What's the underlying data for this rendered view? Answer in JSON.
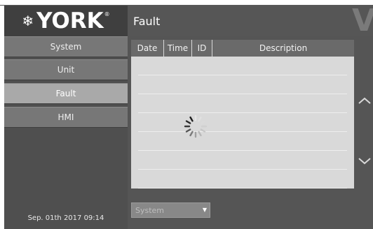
{
  "brand": {
    "name": "YORK",
    "trademark": "®"
  },
  "sidebar": {
    "items": [
      {
        "label": "System"
      },
      {
        "label": "Unit"
      },
      {
        "label": "Fault"
      },
      {
        "label": "HMI"
      }
    ],
    "active": "Fault",
    "datetime": "Sep. 01th 2017  09:14"
  },
  "header": {
    "title": "Fault"
  },
  "table": {
    "columns": [
      "Date",
      "Time",
      "ID",
      "Description"
    ],
    "rows": [],
    "loading": true
  },
  "filter": {
    "selected": "System"
  },
  "icons": {
    "logo": "snowflake-icon",
    "scroll_up": "chevron-up-icon",
    "scroll_down": "chevron-down-icon",
    "loading": "spinner-icon"
  },
  "colors": {
    "sidebar_bg": "#4f4f4f",
    "nav_item": "#777777",
    "nav_active": "#a9a9a9",
    "header_bg": "#565656",
    "table_bg": "#d9d9d9",
    "table_header": "#6a6a6a"
  }
}
